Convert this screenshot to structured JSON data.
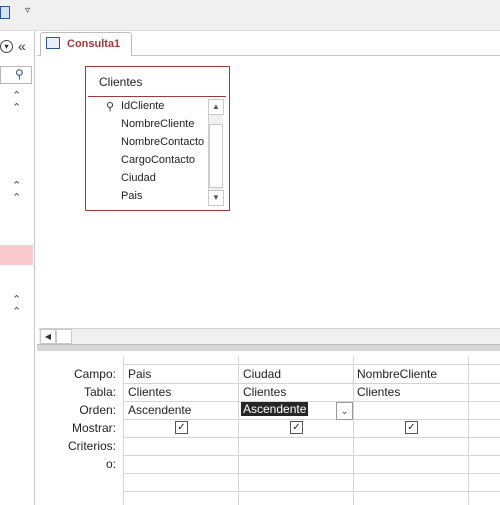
{
  "tab": {
    "title": "Consulta1"
  },
  "table": {
    "name": "Clientes",
    "fields": [
      "IdCliente",
      "NombreCliente",
      "NombreContacto",
      "CargoContacto",
      "Ciudad",
      "Pais"
    ]
  },
  "grid": {
    "row_labels": [
      "Campo:",
      "Tabla:",
      "Orden:",
      "Mostrar:",
      "Criterios:",
      "o:"
    ],
    "columns": [
      {
        "campo": "Pais",
        "tabla": "Clientes",
        "orden": "Ascendente",
        "mostrar": true
      },
      {
        "campo": "Ciudad",
        "tabla": "Clientes",
        "orden": "Ascendente",
        "mostrar": true
      },
      {
        "campo": "NombreCliente",
        "tabla": "Clientes",
        "orden": "",
        "mostrar": true
      }
    ]
  },
  "icons": {
    "primary_key": "key-icon",
    "check": "✓"
  }
}
